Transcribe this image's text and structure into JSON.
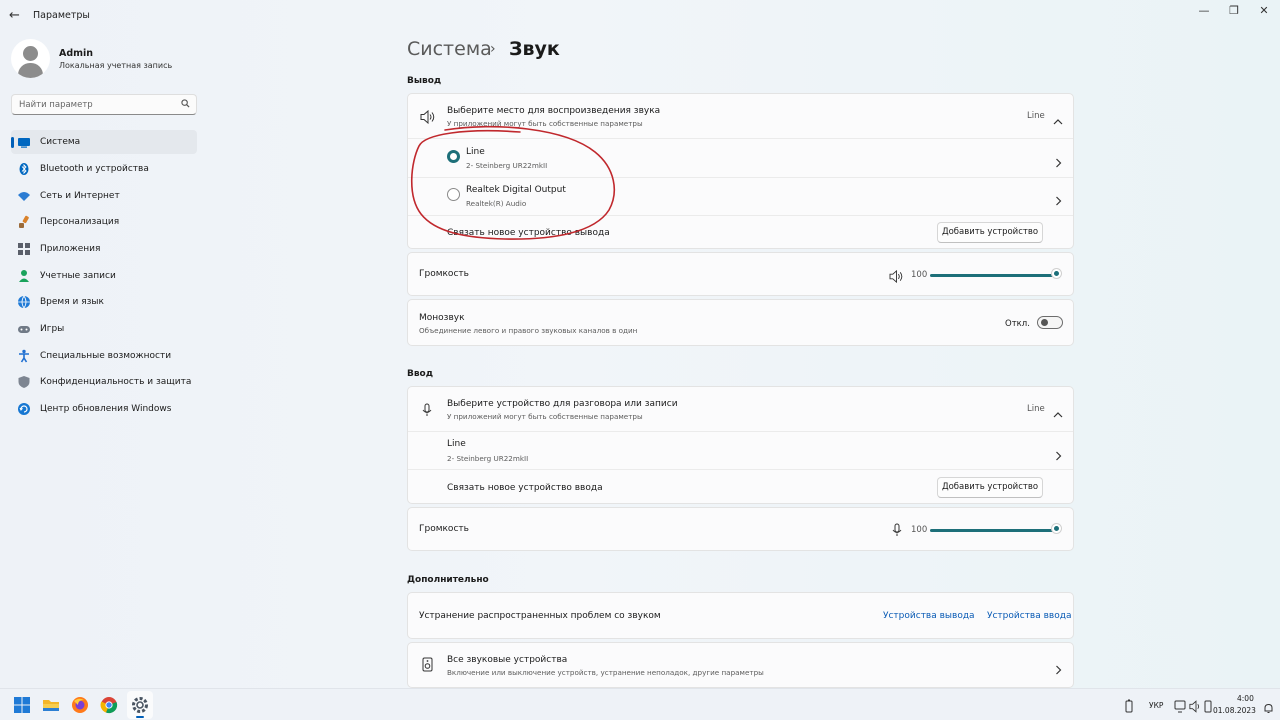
{
  "window": {
    "title": "Параметры",
    "back_glyph": "←",
    "minimize_glyph": "—",
    "restore_glyph": "❐",
    "close_glyph": "✕"
  },
  "user": {
    "name": "Admin",
    "account_type": "Локальная учетная запись"
  },
  "search": {
    "placeholder": "Найти параметр",
    "icon": "search-icon"
  },
  "sidebar": {
    "items": [
      {
        "label": "Система",
        "icon": "system-icon",
        "active": true,
        "color": "#0067c0"
      },
      {
        "label": "Bluetooth и устройства",
        "icon": "bluetooth-icon",
        "color": "#0067c0"
      },
      {
        "label": "Сеть и Интернет",
        "icon": "network-icon",
        "color": "#2b7cd3"
      },
      {
        "label": "Персонализация",
        "icon": "brush-icon",
        "color": "#d9822b"
      },
      {
        "label": "Приложения",
        "icon": "apps-icon",
        "color": "#5a5f6a"
      },
      {
        "label": "Учетные записи",
        "icon": "accounts-icon",
        "color": "#1aa35c"
      },
      {
        "label": "Время и язык",
        "icon": "time-language-icon",
        "color": "#1f7ad6"
      },
      {
        "label": "Игры",
        "icon": "gaming-icon",
        "color": "#707a86"
      },
      {
        "label": "Специальные возможности",
        "icon": "accessibility-icon",
        "color": "#1f6fd1"
      },
      {
        "label": "Конфиденциальность и защита",
        "icon": "shield-icon",
        "color": "#7d8591"
      },
      {
        "label": "Центр обновления Windows",
        "icon": "update-icon",
        "color": "#1677d2"
      }
    ]
  },
  "breadcrumb": {
    "parent": "Система",
    "separator": "›",
    "current": "Звук"
  },
  "output": {
    "heading": "Вывод",
    "header_title": "Выберите место для воспроизведения звука",
    "header_sub": "У приложений могут быть собственные параметры",
    "header_value": "Line",
    "devices": [
      {
        "name": "Line",
        "sub": "2- Steinberg UR22mkII",
        "selected": true
      },
      {
        "name": "Realtek Digital Output",
        "sub": "Realtek(R) Audio",
        "selected": false
      }
    ],
    "pair_label": "Связать новое устройство вывода",
    "add_button": "Добавить устройство",
    "volume_label": "Громкость",
    "volume_value": "100",
    "volume_level": 1.0,
    "mono_title": "Монозвук",
    "mono_sub": "Объединение левого и правого звуковых каналов в один",
    "mono_state": "Откл.",
    "mono_on": false
  },
  "input": {
    "heading": "Ввод",
    "header_title": "Выберите устройство для разговора или записи",
    "header_sub": "У приложений могут быть собственные параметры",
    "header_value": "Line",
    "devices": [
      {
        "name": "Line",
        "sub": "2- Steinberg UR22mkII"
      }
    ],
    "pair_label": "Связать новое устройство ввода",
    "add_button": "Добавить устройство",
    "volume_label": "Громкость",
    "volume_value": "100",
    "volume_level": 1.0
  },
  "advanced": {
    "heading": "Дополнительно",
    "troubleshoot_label": "Устранение распространенных проблем со звуком",
    "troubleshoot_output_link": "Устройства вывода",
    "troubleshoot_input_link": "Устройства ввода",
    "all_devices_title": "Все звуковые устройства",
    "all_devices_sub": "Включение или выключение устройств, устранение неполадок, другие параметры"
  },
  "annotation": {
    "color": "#c0282d"
  },
  "taskbar": {
    "apps": [
      "windows-start-icon",
      "file-explorer-icon",
      "firefox-icon",
      "chrome-icon",
      "settings-icon"
    ],
    "language": "УКР",
    "time": "4:00",
    "date": "01.08.2023"
  },
  "colors": {
    "accent": "#1d6f79",
    "link": "#0a5bb5",
    "nav_indicator": "#005fb8"
  }
}
